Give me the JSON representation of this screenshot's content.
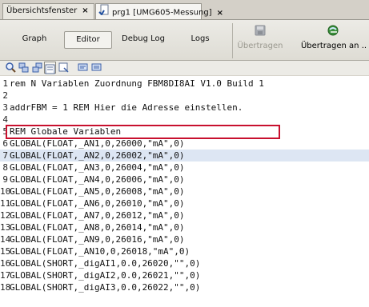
{
  "tabs": [
    {
      "label": "Übersichtsfenster",
      "close": "×",
      "active": false
    },
    {
      "label": "prg1 [UMG605-Messung]",
      "close": "×",
      "active": true
    }
  ],
  "toolbar": {
    "graph": "Graph",
    "editor": "Editor",
    "debug_log": "Debug Log",
    "logs": "Logs",
    "transfer": "Übertragen",
    "transfer_to": "Übertragen an .."
  },
  "icon_toolbar": [
    "zoom-icon",
    "shape-forward-icon",
    "shape-back-icon",
    "outline-active-icon",
    "outline-icon",
    "comment-icon",
    "uncomment-icon"
  ],
  "colors": {
    "highlight_border": "#c8102e",
    "active_line": "#dde6f3"
  },
  "editor": {
    "lines": [
      {
        "num": "1",
        "text": "rem N Variablen Zuordnung FBM8DI8AI V1.0 Build 1"
      },
      {
        "num": "2",
        "text": ""
      },
      {
        "num": "3",
        "text": "addrFBM = 1 REM Hier die Adresse einstellen."
      },
      {
        "num": "4",
        "text": ""
      },
      {
        "num": "5",
        "text": "REM Globale Variablen"
      },
      {
        "num": "6",
        "text": "GLOBAL(FLOAT,_AN1,0,26000,\"mA\",0)"
      },
      {
        "num": "7",
        "text": "GLOBAL(FLOAT,_AN2,0,26002,\"mA\",0)"
      },
      {
        "num": "8",
        "text": "GLOBAL(FLOAT,_AN3,0,26004,\"mA\",0)"
      },
      {
        "num": "9",
        "text": "GLOBAL(FLOAT,_AN4,0,26006,\"mA\",0)"
      },
      {
        "num": "10",
        "text": "GLOBAL(FLOAT,_AN5,0,26008,\"mA\",0)"
      },
      {
        "num": "11",
        "text": "GLOBAL(FLOAT,_AN6,0,26010,\"mA\",0)"
      },
      {
        "num": "12",
        "text": "GLOBAL(FLOAT,_AN7,0,26012,\"mA\",0)"
      },
      {
        "num": "13",
        "text": "GLOBAL(FLOAT,_AN8,0,26014,\"mA\",0)"
      },
      {
        "num": "14",
        "text": "GLOBAL(FLOAT,_AN9,0,26016,\"mA\",0)"
      },
      {
        "num": "15",
        "text": "GLOBAL(FLOAT,_AN10,0,26018,\"mA\",0)"
      },
      {
        "num": "16",
        "text": "GLOBAL(SHORT,_digAI1,0.0,26020,\"\",0)"
      },
      {
        "num": "17",
        "text": "GLOBAL(SHORT,_digAI2,0.0,26021,\"\",0)"
      },
      {
        "num": "18",
        "text": "GLOBAL(SHORT,_digAI3,0.0,26022,\"\",0)"
      }
    ]
  }
}
